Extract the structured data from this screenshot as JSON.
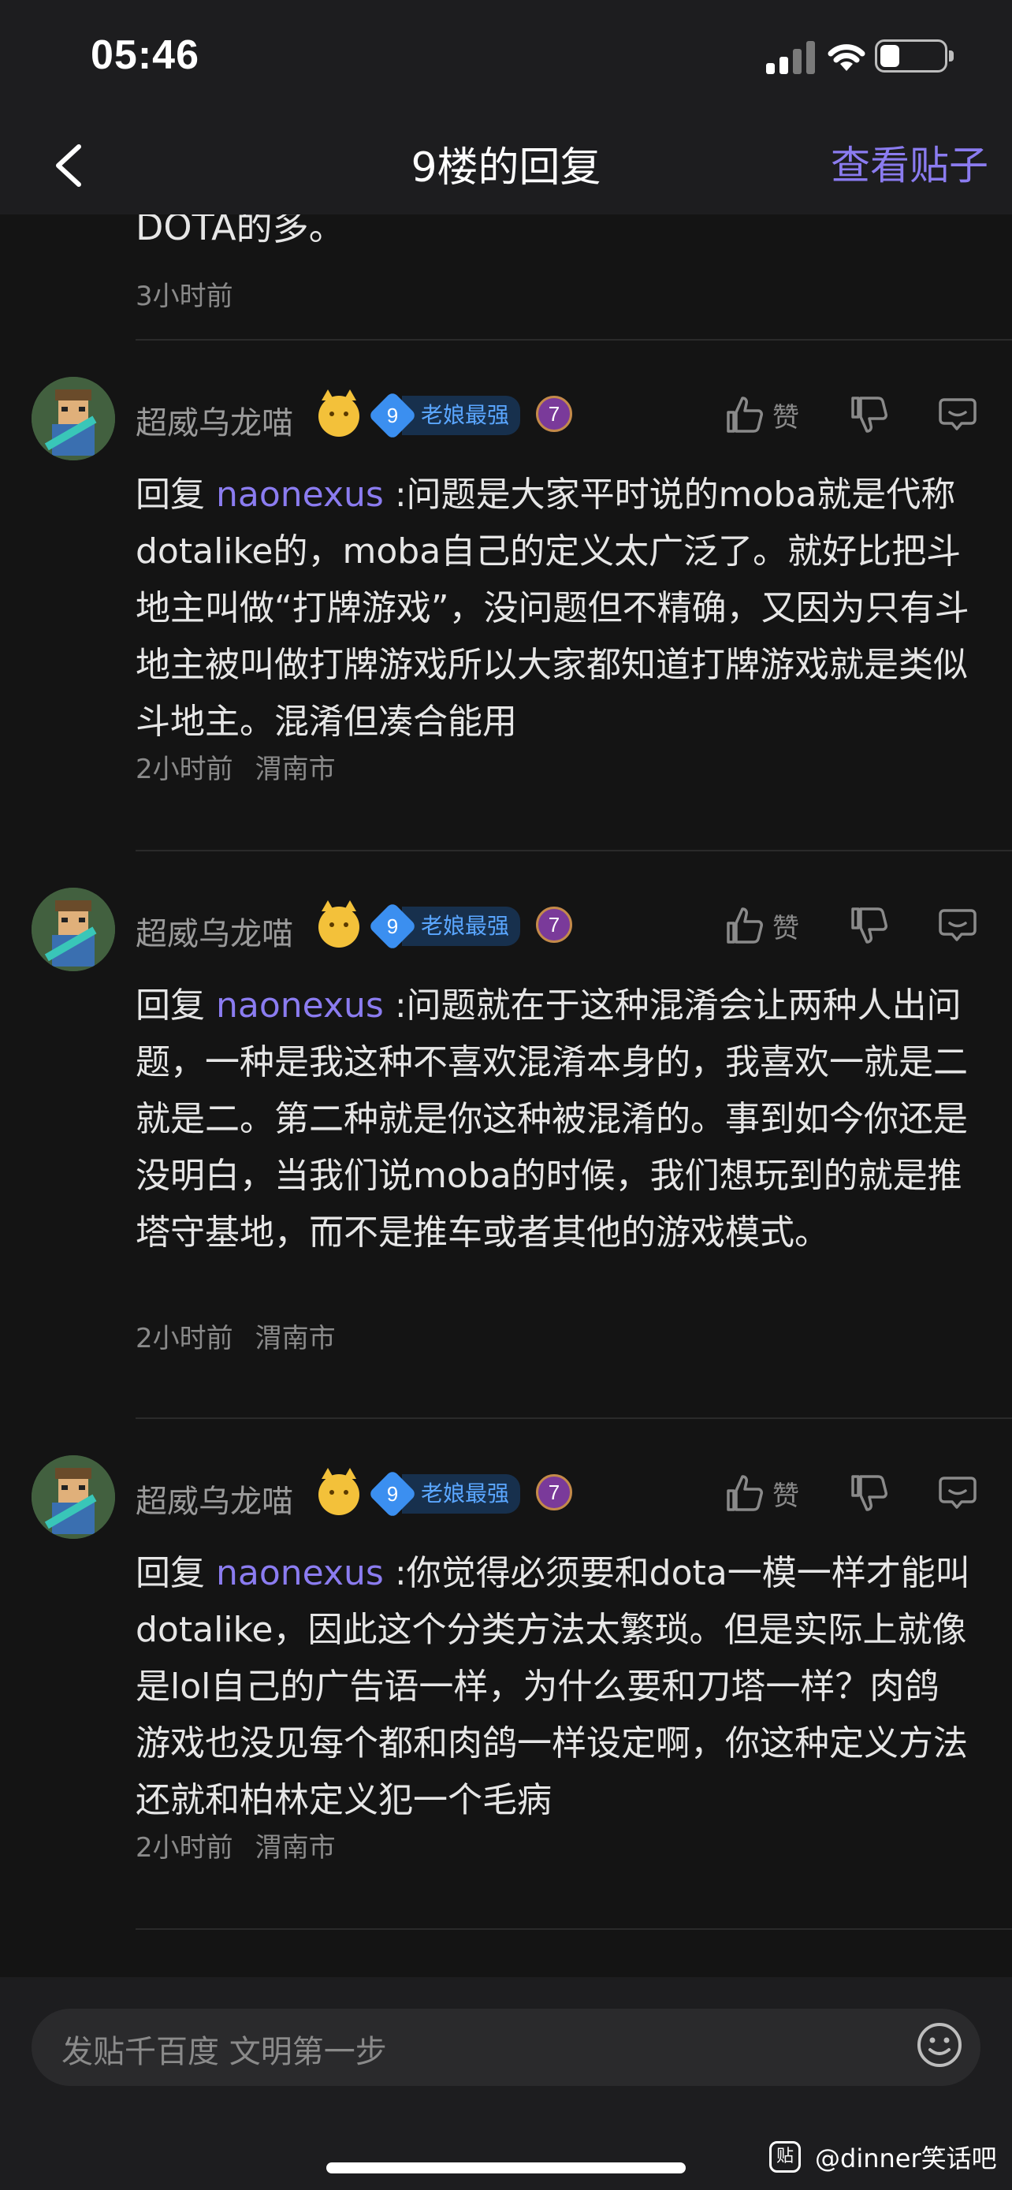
{
  "status": {
    "time": "05:46",
    "battery_level": 0.3
  },
  "nav": {
    "title": "9楼的回复",
    "right_link": "查看贴子"
  },
  "prev": {
    "tail_text": "DOTA的多。",
    "time": "3小时前"
  },
  "common": {
    "like_label": "赞",
    "reply_prefix": "回复",
    "level": "9",
    "level_title": "老娘最强",
    "medal": "7"
  },
  "comments": [
    {
      "username": "超威乌龙喵",
      "mention": "naonexus",
      "text": ":问题是大家平时说的moba就是代称dotalike的，moba自己的定义太广泛了。就好比把斗地主叫做“打牌游戏”，没问题但不精确，又因为只有斗地主被叫做打牌游戏所以大家都知道打牌游戏就是类似斗地主。混淆但凑合能用",
      "time": "2小时前",
      "location": "渭南市"
    },
    {
      "username": "超威乌龙喵",
      "mention": "naonexus",
      "text": ":问题就在于这种混淆会让两种人出问题，一种是我这种不喜欢混淆本身的，我喜欢一就是二就是二。第二种就是你这种被混淆的。事到如今你还是没明白，当我们说moba的时候，我们想玩到的就是推塔守基地，而不是推车或者其他的游戏模式。",
      "time": "2小时前",
      "location": "渭南市"
    },
    {
      "username": "超威乌龙喵",
      "mention": "naonexus",
      "text": ":你觉得必须要和dota一模一样才能叫dotalike，因此这个分类方法太繁琐。但是实际上就像是lol自己的广告语一样，为什么要和刀塔一样？肉鸽游戏也没见每个都和肉鸽一样设定啊，你这种定义方法还就和柏林定义犯一个毛病",
      "time": "2小时前",
      "location": "渭南市"
    }
  ],
  "composer": {
    "placeholder": "发贴千百度 文明第一步"
  },
  "watermark": {
    "logo": "贴",
    "text": "@dinner笑话吧"
  },
  "colors": {
    "accent": "#8b7cf0",
    "background": "#141414",
    "level_blue": "#3b8ff0"
  }
}
